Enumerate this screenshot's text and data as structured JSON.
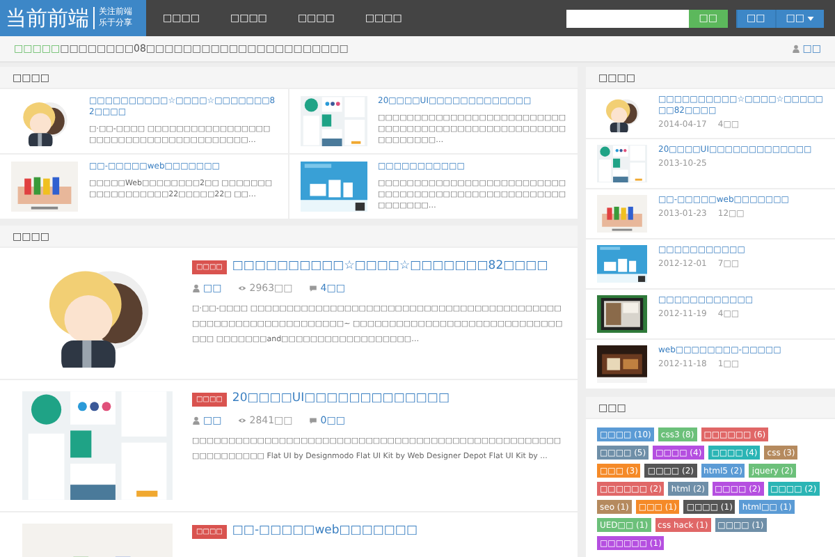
{
  "header": {
    "logo": "当前前端",
    "slogan_lines": [
      "关注前端",
      "乐于分享"
    ],
    "nav": [
      "□□□□",
      "□□□□",
      "□□□□",
      "□□□□"
    ],
    "search": {
      "button": "□□"
    },
    "buttons": [
      {
        "label": "□□",
        "dropdown": false
      },
      {
        "label": "□□",
        "dropdown": true
      }
    ]
  },
  "notice": {
    "label": "□□□□□",
    "text": "□□□□□□□□08□□□□□□□□□□□□□□□□□□□□□□",
    "user": "□□"
  },
  "featured": {
    "title": "□□□□",
    "cards": [
      {
        "title": "□□□□□□□□□□☆□□□□☆□□□□□□□82□□□□",
        "excerpt": "□·□□-□□□□ □□□□□□□□□□□□□□□□□□□□□□□□□□□□□□□□□□□□□□□…"
      },
      {
        "title": "20□□□□UI□□□□□□□□□□□□□",
        "excerpt": "□□□□□□□□□□□□□□□□□□□□□□□□□□□□□□□□□□□□□□□□□□□□□□□□□□□□□□□□□□□□…"
      },
      {
        "title": "□□-□□□□□web□□□□□□□",
        "excerpt": "□□□□□Web□□□□□□□□2□□ □□□□□□□□□□□□□□□□□□22□□□□□22□ □□…"
      },
      {
        "title": "□□□□□□□□□□□",
        "excerpt": "□□□□□□□□□□□□□□□□□□□□□□□□□□□□□□□□□□□□□□□□□□□□□□□□□□□□□□□□□□□…"
      }
    ]
  },
  "latest": {
    "title": "□□□□",
    "articles": [
      {
        "tag": "□□□□",
        "title": "□□□□□□□□□□☆□□□□☆□□□□□□□82□□□□",
        "author": "□□",
        "views": "2963□□",
        "comments": "4□□",
        "excerpt": "□·□□-□□□□ □□□□□□□□□□□□□□□□□□□□□□□□□□□□□□□□□□□□□□□□□□□□□□□□□□□□□□□□□□□□□□□□~ □□□□□□□□□□□□□□□□□□□□□□□□□□□□□□□□ □□□□□□□and□□□□□□□□□□□□□□□□□□…"
      },
      {
        "tag": "□□□□",
        "title": "20□□□□UI□□□□□□□□□□□□□",
        "author": "□□",
        "views": "2841□□",
        "comments": "0□□",
        "excerpt": "□□□□□□□□□□□□□□□□□□□□□□□□□□□□□□□□□□□□□□□□□□□□□□□□□□□□□□□□□□□□□ Flat UI by Designmodo Flat UI Kit by Web Designer Depot Flat UI Kit by ..."
      },
      {
        "tag": "□□□□",
        "title": "□□-□□□□□web□□□□□□□"
      }
    ]
  },
  "popular": {
    "title": "□□□□",
    "items": [
      {
        "title": "□□□□□□□□□□☆□□□□☆□□□□□□□82□□□□",
        "date": "2014-04-17",
        "comments": "4□□"
      },
      {
        "title": "20□□□□UI□□□□□□□□□□□□□",
        "date": "2013-10-25"
      },
      {
        "title": "□□-□□□□□web□□□□□□□",
        "date": "2013-01-23",
        "comments": "12□□"
      },
      {
        "title": "□□□□□□□□□□□",
        "date": "2012-12-01",
        "comments": "7□□"
      },
      {
        "title": "□□□□□□□□□□□□",
        "date": "2012-11-19",
        "comments": "4□□"
      },
      {
        "title": "web□□□□□□□□-□□□□□",
        "date": "2012-11-18",
        "comments": "1□□"
      }
    ]
  },
  "tags": {
    "title": "□□□",
    "items": [
      {
        "label": "□□□□ (10)",
        "color": "#5b9bd5"
      },
      {
        "label": "css3 (8)",
        "color": "#6cc07a"
      },
      {
        "label": "□□□□□□ (6)",
        "color": "#e06767"
      },
      {
        "label": "□□□□ (5)",
        "color": "#6f8fa8"
      },
      {
        "label": "□□□□ (4)",
        "color": "#b54fe0"
      },
      {
        "label": "□□□□ (4)",
        "color": "#2bb5b5"
      },
      {
        "label": "css (3)",
        "color": "#b58a5e"
      },
      {
        "label": "□□□ (3)",
        "color": "#f58a28"
      },
      {
        "label": "□□□□ (2)",
        "color": "#555555"
      },
      {
        "label": "html5 (2)",
        "color": "#5b9bd5"
      },
      {
        "label": "jquery (2)",
        "color": "#6cc07a"
      },
      {
        "label": "□□□□□□ (2)",
        "color": "#e06767"
      },
      {
        "label": "html (2)",
        "color": "#6f8fa8"
      },
      {
        "label": "□□□□ (2)",
        "color": "#b54fe0"
      },
      {
        "label": "□□□□ (2)",
        "color": "#2bb5b5"
      },
      {
        "label": "seo (1)",
        "color": "#b58a5e"
      },
      {
        "label": "□□□ (1)",
        "color": "#f58a28"
      },
      {
        "label": "□□□□ (1)",
        "color": "#555555"
      },
      {
        "label": "html□□ (1)",
        "color": "#5b9bd5"
      },
      {
        "label": "UED□□ (1)",
        "color": "#6cc07a"
      },
      {
        "label": "css hack (1)",
        "color": "#e06767"
      },
      {
        "label": "□□□□ (1)",
        "color": "#6f8fa8"
      },
      {
        "label": "□□□□□□ (1)",
        "color": "#b54fe0"
      }
    ]
  }
}
